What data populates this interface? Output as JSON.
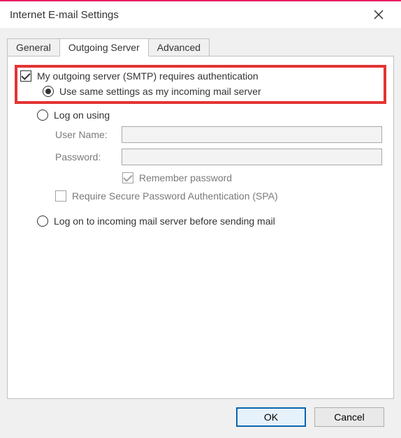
{
  "window": {
    "title": "Internet E-mail Settings"
  },
  "tabs": {
    "general": "General",
    "outgoing": "Outgoing Server",
    "advanced": "Advanced"
  },
  "form": {
    "requires_auth": "My outgoing server (SMTP) requires authentication",
    "use_same": "Use same settings as my incoming mail server",
    "log_on_using": "Log on using",
    "user_name_label": "User Name:",
    "password_label": "Password:",
    "remember_password": "Remember password",
    "require_spa": "Require Secure Password Authentication (SPA)",
    "log_on_before": "Log on to incoming mail server before sending mail"
  },
  "buttons": {
    "ok": "OK",
    "cancel": "Cancel"
  }
}
